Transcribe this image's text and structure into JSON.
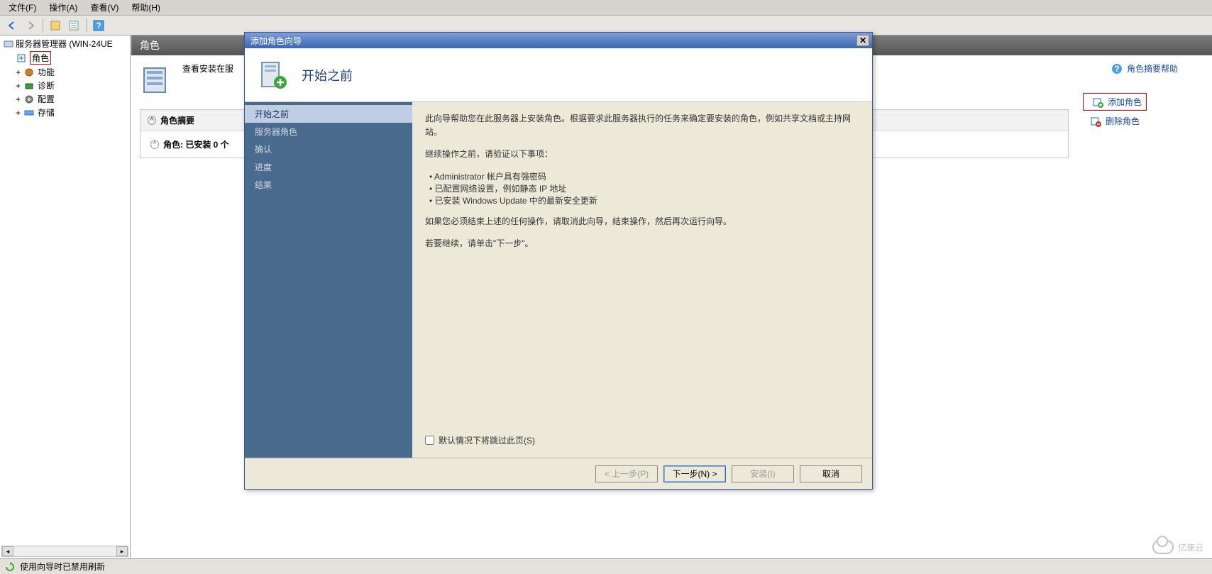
{
  "menu": {
    "file": "文件(F)",
    "action": "操作(A)",
    "view": "查看(V)",
    "help": "帮助(H)"
  },
  "tree": {
    "root": "服务器管理器 (WIN-24UE",
    "items": [
      "角色",
      "功能",
      "诊断",
      "配置",
      "存储"
    ]
  },
  "content": {
    "header": "角色",
    "desc": "查看安装在服",
    "summary_title": "角色摘要",
    "installed": "角色: 已安装 0 个",
    "help": "角色摘要帮助",
    "add": "添加角色",
    "remove": "删除角色"
  },
  "wizard": {
    "title": "添加角色向导",
    "banner": "开始之前",
    "steps": [
      "开始之前",
      "服务器角色",
      "确认",
      "进度",
      "结果"
    ],
    "intro": "此向导帮助您在此服务器上安装角色。根据要求此服务器执行的任务来确定要安装的角色，例如共享文档或主持网站。",
    "verify": "继续操作之前，请验证以下事项：",
    "bullets": [
      "Administrator 帐户具有强密码",
      "已配置网络设置，例如静态 IP 地址",
      "已安装 Windows Update 中的最新安全更新"
    ],
    "tail1": "如果您必须结束上述的任何操作，请取消此向导，结束操作，然后再次运行向导。",
    "tail2": "若要继续，请单击\"下一步\"。",
    "skip": "默认情况下将跳过此页(S)",
    "btn_prev": "< 上一步(P)",
    "btn_next": "下一步(N) >",
    "btn_install": "安装(I)",
    "btn_cancel": "取消"
  },
  "status": "使用向导时已禁用刷新",
  "watermark": "亿速云"
}
